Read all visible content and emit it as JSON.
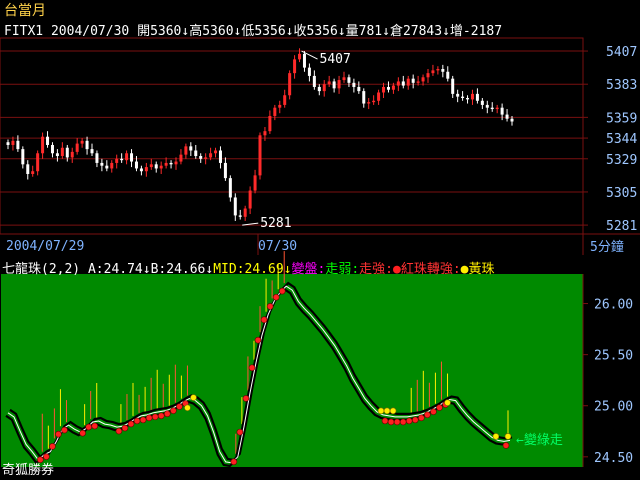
{
  "header": {
    "title": "台當月",
    "symbol": "FITX1",
    "date": "2004/07/30",
    "open_label": "開5360↓",
    "high_label": "高5360↓",
    "low_label": "低5356↓",
    "close_label": "收5356↓",
    "volume_label": "量781↓",
    "oi_label": "倉27843↓",
    "change_label": "增-2187"
  },
  "indicator_bar": {
    "name": "七龍珠(2,2)",
    "a_label": "A:24.74↓",
    "b_label": "B:24.66↓",
    "mid_label": "MID:24.69↓",
    "bian_pan": "變盤:",
    "zou_ruo": "走弱:",
    "zou_qiang": "走強:",
    "red_bead": "紅珠轉強:",
    "yellow_bead": "黃珠"
  },
  "footer": {
    "brand": "奇狐勝券",
    "interval": "5分鐘",
    "arrow_note": "←變綠走"
  },
  "colors": {
    "up": "#ff2a2a",
    "down": "#ffffff",
    "indicator_bg": "#008a00",
    "grid": "#7a1010",
    "axis_text": "#9fc7ff",
    "bian_pan": "#ff00ff",
    "zou_ruo": "#00ff00",
    "zou_qiang": "#ff3333",
    "red_bead": "#ff2020",
    "yellow_bead": "#ffee00"
  },
  "chart_data": [
    {
      "type": "candlestick",
      "title": "",
      "x_labels": [
        "2004/07/29",
        "07/30"
      ],
      "y_ticks": [
        5281,
        5305,
        5329,
        5344,
        5359,
        5383,
        5407
      ],
      "ylim": [
        5276,
        5415
      ],
      "annotations": [
        {
          "text": "5407",
          "value": 5407
        },
        {
          "text": "5281",
          "value": 5281
        }
      ],
      "grid": true,
      "closes": [
        5339,
        5342,
        5336,
        5325,
        5318,
        5320,
        5333,
        5345,
        5339,
        5333,
        5331,
        5337,
        5330,
        5334,
        5340,
        5342,
        5336,
        5333,
        5326,
        5324,
        5322,
        5326,
        5329,
        5328,
        5333,
        5327,
        5322,
        5320,
        5323,
        5325,
        5322,
        5324,
        5326,
        5325,
        5327,
        5332,
        5338,
        5335,
        5331,
        5329,
        5330,
        5333,
        5335,
        5326,
        5315,
        5301,
        5288,
        5287,
        5293,
        5306,
        5317,
        5346,
        5349,
        5360,
        5366,
        5368,
        5375,
        5391,
        5401,
        5405,
        5395,
        5389,
        5381,
        5378,
        5383,
        5385,
        5380,
        5386,
        5388,
        5384,
        5381,
        5378,
        5369,
        5370,
        5371,
        5377,
        5381,
        5379,
        5382,
        5385,
        5382,
        5387,
        5384,
        5385,
        5388,
        5391,
        5393,
        5394,
        5392,
        5387,
        5376,
        5374,
        5373,
        5372,
        5376,
        5371,
        5368,
        5366,
        5365,
        5366,
        5361,
        5358,
        5356
      ]
    },
    {
      "type": "line",
      "title": "七龍珠(2,2)",
      "y_ticks": [
        24.5,
        25.0,
        25.5,
        26.0
      ],
      "ylim": [
        24.42,
        26.25
      ],
      "series": [
        {
          "name": "A",
          "last": 24.74
        },
        {
          "name": "B",
          "last": 24.66
        },
        {
          "name": "MID",
          "last": 24.69
        }
      ],
      "mid": [
        24.96,
        24.92,
        24.78,
        24.65,
        24.58,
        24.5,
        24.55,
        24.58,
        24.68,
        24.8,
        24.84,
        24.8,
        24.77,
        24.81,
        24.87,
        24.88,
        24.85,
        24.84,
        24.82,
        24.83,
        24.86,
        24.9,
        24.93,
        24.94,
        24.96,
        24.97,
        24.98,
        25.0,
        25.03,
        25.07,
        25.1,
        25.08,
        25.03,
        24.93,
        24.77,
        24.58,
        24.48,
        24.47,
        24.53,
        24.82,
        25.15,
        25.45,
        25.72,
        25.92,
        26.05,
        26.14,
        26.2,
        26.16,
        26.05,
        25.98,
        25.92,
        25.85,
        25.78,
        25.7,
        25.62,
        25.52,
        25.42,
        25.3,
        25.2,
        25.1,
        25.03,
        24.97,
        24.94,
        24.93,
        24.92,
        24.92,
        24.92,
        24.93,
        24.94,
        24.96,
        24.99,
        25.02,
        25.06,
        25.09,
        25.08,
        25.0,
        24.93,
        24.87,
        24.82,
        24.77,
        24.72,
        24.69,
        24.68,
        24.69
      ],
      "yellow_points": [
        24.98,
        25.08,
        25.03,
        24.95,
        24.95,
        24.95,
        24.7,
        24.7
      ],
      "grid": false
    }
  ]
}
